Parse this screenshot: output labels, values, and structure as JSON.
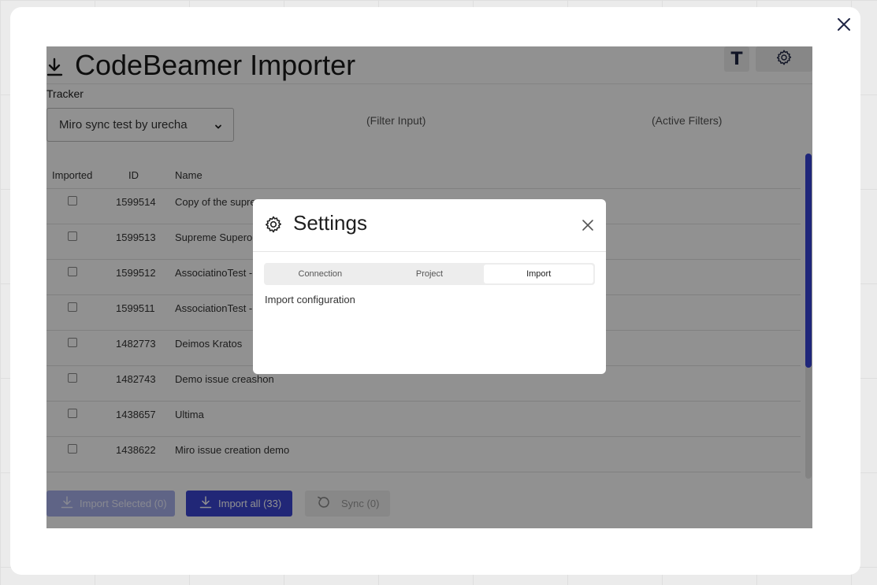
{
  "app": {
    "title": "CodeBeamer Importer",
    "t_button": "T"
  },
  "tracker": {
    "label": "Tracker",
    "selected": "Miro sync test by urecha"
  },
  "filters": {
    "filter_input": "(Filter Input)",
    "active_filters": "(Active Filters)"
  },
  "table": {
    "columns": [
      "Imported",
      "ID",
      "Name"
    ],
    "rows": [
      {
        "id": "1599514",
        "name": "Copy of the supre"
      },
      {
        "id": "1599513",
        "name": "Supreme Superor"
      },
      {
        "id": "1599512",
        "name": "AssociatinoTest -"
      },
      {
        "id": "1599511",
        "name": "AssociationTest -"
      },
      {
        "id": "1482773",
        "name": "Deimos Kratos"
      },
      {
        "id": "1482743",
        "name": "Demo issue creashon"
      },
      {
        "id": "1438657",
        "name": "Ultima"
      },
      {
        "id": "1438622",
        "name": "Miro issue creation demo"
      }
    ]
  },
  "actions": {
    "import_selected": "Import Selected (0)",
    "import_all": "Import all (33)",
    "sync": "Sync (0)"
  },
  "settings": {
    "title": "Settings",
    "tabs": [
      "Connection",
      "Project",
      "Import"
    ],
    "active_tab": "Import",
    "content": "Import configuration"
  },
  "colors": {
    "accent": "#3a45d1",
    "scrollbar": "#3744d6"
  }
}
